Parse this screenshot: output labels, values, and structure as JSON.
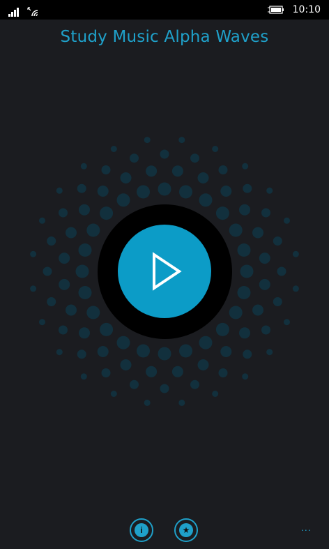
{
  "status_bar": {
    "time": "10:10",
    "icons": [
      "signal-icon",
      "wifi-icon",
      "battery-charging-icon"
    ]
  },
  "app": {
    "title": "Study Music Alpha Waves"
  },
  "player": {
    "state": "paused",
    "play_icon": "play-icon"
  },
  "app_bar": {
    "buttons": [
      "info-icon",
      "star-icon"
    ],
    "more": "..."
  },
  "colors": {
    "background": "#1b1c20",
    "accent": "#1fa0c9",
    "play_button": "#0c9cc7",
    "dots": "#12303d"
  }
}
